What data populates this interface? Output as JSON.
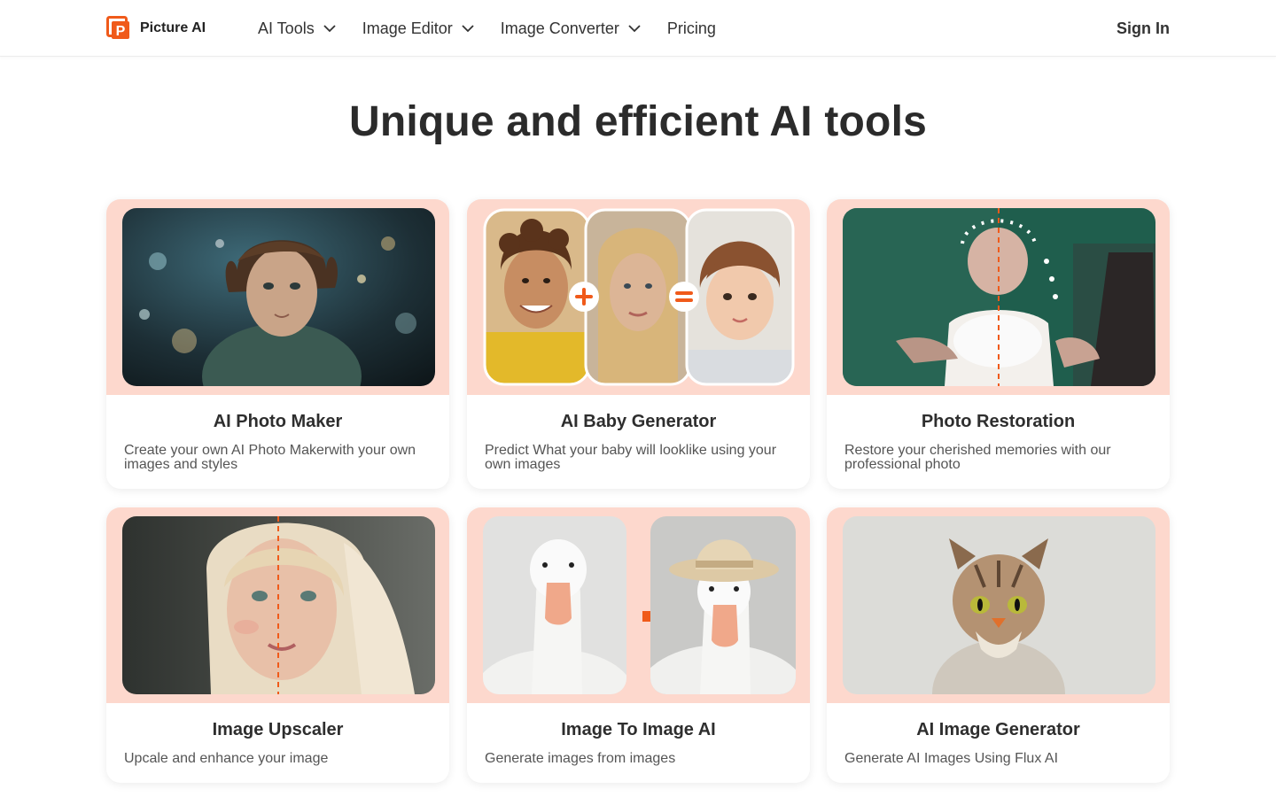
{
  "header": {
    "logo_text": "Picture AI",
    "nav": [
      {
        "label": "AI Tools",
        "has_dropdown": true
      },
      {
        "label": "Image Editor",
        "has_dropdown": true
      },
      {
        "label": "Image Converter",
        "has_dropdown": true
      },
      {
        "label": "Pricing",
        "has_dropdown": false
      }
    ],
    "signin_label": "Sign In"
  },
  "page": {
    "title": "Unique and efficient AI tools"
  },
  "colors": {
    "brand": "#f05a1a",
    "card_band": "#fdd8cd"
  },
  "cards": [
    {
      "title": "AI Photo Maker",
      "description": "Create your own AI Photo Makerwith your own images and styles",
      "image": "portrait-bokeh"
    },
    {
      "title": "AI Baby Generator",
      "description": "Predict What your baby will looklike using your own images",
      "image": "parents-plus-baby"
    },
    {
      "title": "Photo Restoration",
      "description": "Restore your cherished memories with our professional photo",
      "image": "before-after-restoration"
    },
    {
      "title": "Image Upscaler",
      "description": "Upcale and enhance your image",
      "image": "before-after-portrait"
    },
    {
      "title": "Image To Image AI",
      "description": "Generate images from images",
      "image": "goose-to-goose-with-hat"
    },
    {
      "title": "AI Image Generator",
      "description": "Generate AI Images Using Flux AI",
      "image": "cat-portrait"
    }
  ]
}
